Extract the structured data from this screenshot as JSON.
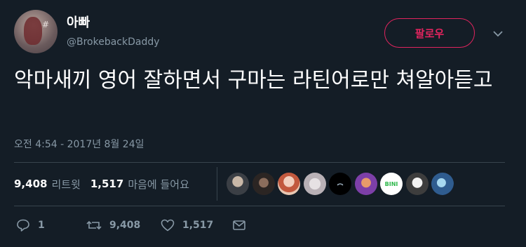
{
  "author": {
    "display_name": "아빠",
    "handle": "@BrokebackDaddy",
    "avatar_icon": "profile-photo"
  },
  "follow_button": {
    "label": "팔로우",
    "color": "#e0245e"
  },
  "more_menu": {
    "icon": "chevron-down-icon"
  },
  "tweet": {
    "text": "악마새끼 영어 잘하면서 구마는 라틴어로만 쳐알아듣고",
    "timestamp": "오전 4:54 - 2017년 8월 24일"
  },
  "stats": {
    "retweets": "9,408",
    "retweets_label": "리트윗",
    "likes": "1,517",
    "likes_label": "마음에 들어요"
  },
  "liker_avatars": [
    {
      "name": "liker-1",
      "color": "#5a5f66"
    },
    {
      "name": "liker-2",
      "color": "#4a3c36"
    },
    {
      "name": "liker-3",
      "color": "#d9a48e"
    },
    {
      "name": "liker-4",
      "color": "#c9c3c5"
    },
    {
      "name": "liker-5",
      "color": "#000000"
    },
    {
      "name": "liker-6",
      "color": "#8a4fb0"
    },
    {
      "name": "liker-7",
      "color": "#ffffff",
      "text": "BINI"
    },
    {
      "name": "liker-8",
      "color": "#cfcfcf"
    },
    {
      "name": "liker-9",
      "color": "#3a6ea8"
    }
  ],
  "actions": {
    "reply_count": "1",
    "retweet_count": "9,408",
    "like_count": "1,517"
  },
  "colors": {
    "background": "#141d26",
    "text_secondary": "#8899a6",
    "divider": "#38444d",
    "accent": "#e0245e"
  }
}
